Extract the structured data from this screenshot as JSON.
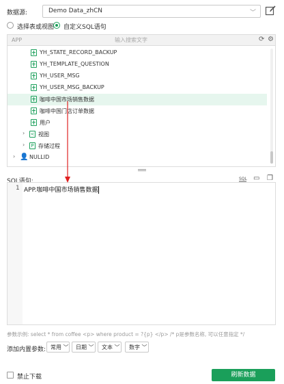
{
  "datasource": {
    "label": "数据源:",
    "value": "Demo Data_zhCN"
  },
  "mode": {
    "options": [
      {
        "label": "选择表或视图",
        "selected": false
      },
      {
        "label": "自定义SQL语句",
        "selected": true
      }
    ]
  },
  "tree": {
    "header_app": "APP",
    "search_placeholder": "输入搜索文字",
    "items": [
      {
        "label": "YH_STATE_RECORD_BACKUP",
        "type": "table"
      },
      {
        "label": "YH_TEMPLATE_QUESTION",
        "type": "table"
      },
      {
        "label": "YH_USER_MSG",
        "type": "table"
      },
      {
        "label": "YH_USER_MSG_BACKUP",
        "type": "table"
      },
      {
        "label": "咖啡中国市场销售数据",
        "type": "table",
        "selected": true
      },
      {
        "label": "咖啡中国门店订单数据",
        "type": "table"
      },
      {
        "label": "用户",
        "type": "table"
      },
      {
        "label": "视图",
        "type": "folder"
      },
      {
        "label": "存储过程",
        "type": "folder"
      },
      {
        "label": "NULLID",
        "type": "schema"
      }
    ]
  },
  "sql": {
    "label": "SQL语句:",
    "line_number": "1",
    "text": "APP.咖啡中国市场销售数据"
  },
  "example_text": "参数示例: select * from coffee <p> where product = ?{p} </p> /* p是参数名称, 可以任意指定 */",
  "builtin": {
    "label": "添加内置参数:",
    "dropdowns": [
      "常用",
      "日期",
      "文本",
      "数字"
    ]
  },
  "disable_download_label": "禁止下载",
  "refresh_button": "刷新数据",
  "colors": {
    "accent": "#1a9f5a",
    "selected_row": "#e6f6ee",
    "arrow": "#e02020"
  },
  "icons": [
    "edit-icon",
    "refresh-icon",
    "settings-icon",
    "table-icon",
    "view-icon",
    "procedure-icon",
    "user-icon",
    "format-sql-icon",
    "comment-icon",
    "copy-icon"
  ]
}
